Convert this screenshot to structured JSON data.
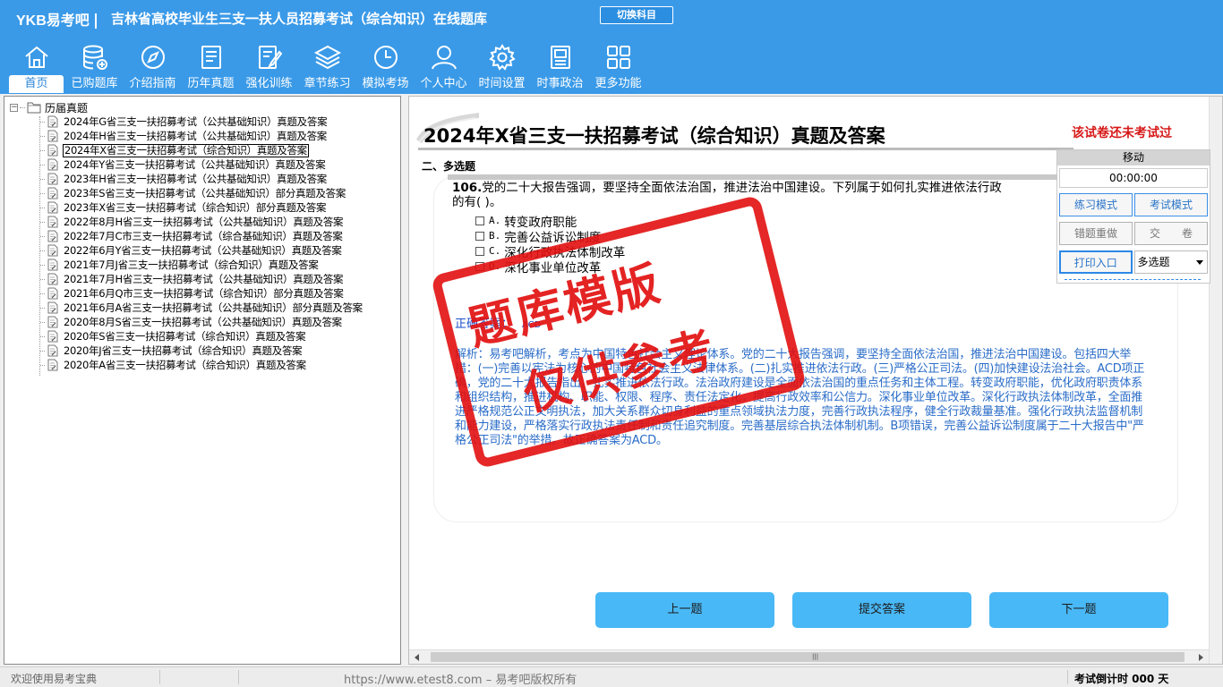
{
  "header": {
    "brand": "YKB易考吧",
    "title": "吉林省高校毕业生三支一扶人员招募考试（综合知识）在线题库",
    "switch_label": "切换科目"
  },
  "nav": [
    {
      "label": "首页",
      "icon": "home-icon",
      "active": true
    },
    {
      "label": "已购题库",
      "icon": "database-icon"
    },
    {
      "label": "介绍指南",
      "icon": "compass-icon"
    },
    {
      "label": "历年真题",
      "icon": "document-list-icon"
    },
    {
      "label": "强化训练",
      "icon": "edit-icon"
    },
    {
      "label": "章节练习",
      "icon": "layers-icon"
    },
    {
      "label": "模拟考场",
      "icon": "clock-icon"
    },
    {
      "label": "个人中心",
      "icon": "user-icon"
    },
    {
      "label": "时间设置",
      "icon": "gear-icon"
    },
    {
      "label": "时事政治",
      "icon": "news-icon"
    },
    {
      "label": "更多功能",
      "icon": "grid-icon"
    }
  ],
  "tree": {
    "root_toggle": "−",
    "root": "历届真题",
    "items": [
      "2024年G省三支一扶招募考试（公共基础知识）真题及答案",
      "2024年H省三支一扶招募考试（公共基础知识）真题及答案",
      "2024年X省三支一扶招募考试（综合知识）真题及答案",
      "2024年Y省三支一扶招募考试（公共基础知识）真题及答案",
      "2023年H省三支一扶招募考试（公共基础知识）真题及答案",
      "2023年S省三支一扶招募考试（公共基础知识）部分真题及答案",
      "2023年X省三支一扶招募考试（综合知识）部分真题及答案",
      "2022年8月H省三支一扶招募考试（公共基础知识）真题及答案",
      "2022年7月C市三支一扶招募考试（综合基础知识）真题及答案",
      "2022年6月Y省三支一扶招募考试（公共基础知识）真题及答案",
      "2021年7月J省三支一扶招募考试（综合知识）真题及答案",
      "2021年7月H省三支一扶招募考试（公共基础知识）真题及答案",
      "2021年6月Q市三支一扶招募考试（综合知识）部分真题及答案",
      "2021年6月A省三支一扶招募考试（公共基础知识）部分真题及答案",
      "2020年8月S省三支一扶招募考试（公共基础知识）真题及答案",
      "2020年S省三支一扶招募考试（综合知识）真题及答案",
      "2020年J省三支一扶招募考试（综合知识）真题及答案",
      "2020年A省三支一扶招募考试（综合知识）真题及答案"
    ],
    "selected_index": 2
  },
  "paper": {
    "title": "2024年X省三支一扶招募考试（综合知识）真题及答案",
    "status": "该试卷还未考试过",
    "section": "二、多选题"
  },
  "question": {
    "number": "106.",
    "text": "党的二十大报告强调，要坚持全面依法治国，推进法治中国建设。下列属于如何扎实推进依法行政",
    "text_cont": "的有( )。",
    "options": [
      {
        "letter": "A.",
        "text": "转变政府职能"
      },
      {
        "letter": "B.",
        "text": "完善公益诉讼制度"
      },
      {
        "letter": "C.",
        "text": "深化行政执法体制改革"
      },
      {
        "letter": "D.",
        "text": "深化事业单位改革"
      }
    ],
    "answer_label": "正确答案：",
    "answer_value": "ACD",
    "analysis": "解析：易考吧解析，考点为中国特色社会主义理论体系。党的二十大报告强调，要坚持全面依法治国，推进法治中国建设。包括四大举措：(一)完善以宪法为核心的中国特色社会主义法律体系。(二)扎实推进依法行政。(三)严格公正司法。(四)加快建设法治社会。ACD项正确，党的二十大报告指出，扎实推进依法行政。法治政府建设是全面依法治国的重点任务和主体工程。转变政府职能，优化政府职责体系和组织结构，推进机构、职能、权限、程序、责任法定化，提高行政效率和公信力。深化事业单位改革。深化行政执法体制改革，全面推进严格规范公正文明执法，加大关系群众切身利益的重点领域执法力度，完善行政执法程序，健全行政裁量基准。强化行政执法监督机制和能力建设，严格落实行政执法责任制和责任追究制度。完善基层综合执法体制机制。B项错误，完善公益诉讼制度属于二十大报告中\"严格公正司法\"的举措。故正确答案为ACD。"
  },
  "control_panel": {
    "move": "移动",
    "timer": "00:00:00",
    "practice_mode": "练习模式",
    "exam_mode": "考试模式",
    "wrong_redo": "错题重做",
    "submit_paper": "交　　卷",
    "print": "打印入口",
    "type_select": "多选题"
  },
  "buttons": {
    "prev": "上一题",
    "submit": "提交答案",
    "next": "下一题"
  },
  "watermark": {
    "line1": "题库模版",
    "line2": "仅供参考"
  },
  "statusbar": {
    "welcome": "欢迎使用易考宝典",
    "url": "https://www.etest8.com – 易考吧版权所有",
    "countdown": "考试倒计时 000 天"
  },
  "colors": {
    "header_bg": "#3a9ae8",
    "button_bg": "#49b8f6",
    "status_red": "#d71818",
    "analysis_blue": "#2a6cc8",
    "stamp_red": "#e21010"
  }
}
